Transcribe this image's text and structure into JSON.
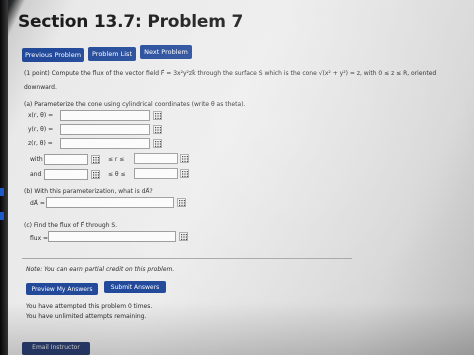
{
  "page": {
    "title": "Section 13.7: Problem 7"
  },
  "nav": {
    "previous_label": "Previous Problem",
    "list_label": "Problem List",
    "next_label": "Next Problem"
  },
  "problem": {
    "intro_line1": "(1 point) Compute the flux of the vector field F⃗ = 3x²y²zk⃗ through the surface S which is the cone √(x² + y²) = z, with 0 ≤ z ≤ R, oriented",
    "intro_line2": "downward.",
    "part_a": "(a) Parameterize the cone using cylindrical coordinates (write θ as theta).",
    "x_label": "x(r, θ) =",
    "y_label": "y(r, θ) =",
    "z_label": "z(r, θ) =",
    "with_label": "with",
    "and_label": "and",
    "r_ineq": "≤ r ≤",
    "theta_ineq": "≤ θ ≤",
    "part_b": "(b) With this parameterization, what is dA⃗?",
    "dA_label": "dA⃗ =",
    "part_c": "(c) Find the flux of F⃗ through S.",
    "flux_label": "flux ="
  },
  "footer": {
    "note": "Note: You can earn partial credit on this problem.",
    "preview_label": "Preview My Answers",
    "submit_label": "Submit Answers",
    "attempts_line": "You have attempted this problem 0 times.",
    "unlimited_line": "You have unlimited attempts remaining.",
    "email_label": "Email Instructor"
  },
  "colors": {
    "button": "#234a9a",
    "field_border": "#9a9a9a",
    "rule": "#a7a7a7"
  },
  "icons": {
    "answer_grid": "grid-icon"
  }
}
